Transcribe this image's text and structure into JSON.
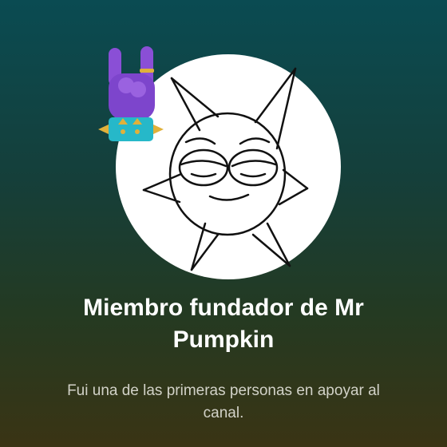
{
  "membership": {
    "title": "Miembro fundador de Mr Pumpkin",
    "description": "Fui una de las primeras personas en apoyar al canal."
  },
  "icons": {
    "avatar": "sun-cartoon-avatar",
    "badge": "rock-hand-sticker"
  },
  "colors": {
    "gradient_top": "#0a4b52",
    "gradient_bottom": "#3a3414",
    "badge_hand": "#8a4fd6",
    "badge_cuff": "#26b8c9"
  }
}
